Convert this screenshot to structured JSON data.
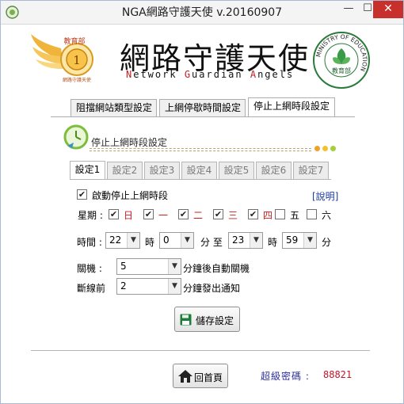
{
  "window": {
    "title": "NGA網路守護天使 v.20160907",
    "minimize": "—",
    "maximize": "☐",
    "close": "✕"
  },
  "header": {
    "brand_cn": "網路守護天使",
    "brand_en": [
      {
        "hl": "N",
        "rest": "etwork "
      },
      {
        "hl": "G",
        "rest": "uardian "
      },
      {
        "hl": "A",
        "rest": "ngels"
      }
    ],
    "badge_text": "教育部",
    "badge_num": "1",
    "badge_sub": "網路守護天使",
    "moe_ring": "MINISTRY OF EDUCATION",
    "moe_center": "教育部"
  },
  "main_tabs": [
    {
      "label": "阻擋網站類型設定",
      "active": false
    },
    {
      "label": "上網停歇時間設定",
      "active": false
    },
    {
      "label": "停止上網時段設定",
      "active": true
    }
  ],
  "section": {
    "title": "停止上網時段設定",
    "dot_colors": [
      "#f0a12a",
      "#f3c12f",
      "#a6cf3c"
    ]
  },
  "sub_tabs": [
    {
      "label": "設定1",
      "active": true
    },
    {
      "label": "設定2",
      "active": false
    },
    {
      "label": "設定3",
      "active": false
    },
    {
      "label": "設定4",
      "active": false
    },
    {
      "label": "設定5",
      "active": false
    },
    {
      "label": "設定6",
      "active": false
    },
    {
      "label": "設定7",
      "active": false
    }
  ],
  "form": {
    "enable_label": "啟動停止上網時段",
    "enable_checked": true,
    "help_link": "[說明]",
    "weekday_label": "星期 :",
    "days": [
      {
        "label": "日",
        "checked": true,
        "red": true
      },
      {
        "label": "一",
        "checked": true,
        "red": true
      },
      {
        "label": "二",
        "checked": true,
        "red": true
      },
      {
        "label": "三",
        "checked": true,
        "red": true
      },
      {
        "label": "四",
        "checked": true,
        "red": true
      },
      {
        "label": "五",
        "checked": false,
        "red": false
      },
      {
        "label": "六",
        "checked": false,
        "red": false
      }
    ],
    "time_label": "時間 :",
    "start_hour": "22",
    "hour_unit": "時",
    "start_minute": "0",
    "minute_to": "分 至",
    "end_hour": "23",
    "end_minute": "59",
    "minute_unit": "分",
    "shutdown_label": "關機 :",
    "shutdown_value": "5",
    "shutdown_suffix": "分鐘後自動關機",
    "disconnect_label": "斷線前",
    "disconnect_value": "2",
    "disconnect_suffix": "分鐘發出通知",
    "save_label": "儲存設定"
  },
  "footer": {
    "home_label": "回首頁",
    "super_password_label": "超級密碼 :",
    "super_password_value": "88821"
  }
}
